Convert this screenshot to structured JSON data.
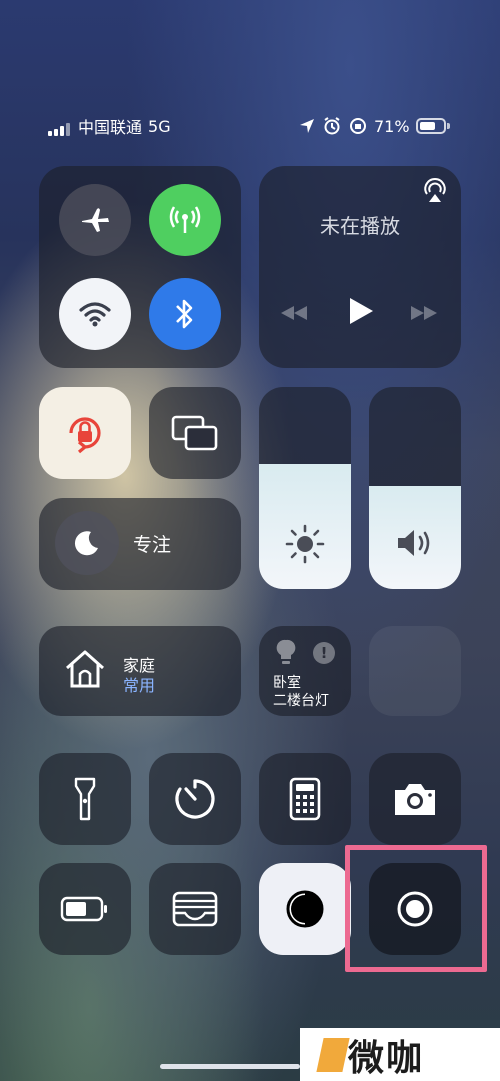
{
  "status_bar": {
    "carrier": "中国联通",
    "network": "5G",
    "battery_percent": "71%",
    "battery_level": 0.71
  },
  "connectivity": {
    "airplane_icon": "airplane-icon",
    "cellular_icon": "antenna-icon",
    "wifi_icon": "wifi-icon",
    "bluetooth_icon": "bluetooth-icon",
    "cellular_color": "#4fcf60",
    "bluetooth_color": "#2f7ae9"
  },
  "media": {
    "status": "未在播放"
  },
  "focus": {
    "label": "专注"
  },
  "home": {
    "title": "家庭",
    "subtitle": "常用"
  },
  "accessory": {
    "room": "卧室",
    "name": "二楼台灯"
  },
  "sliders": {
    "brightness_level": 0.62,
    "volume_level": 0.51
  },
  "watermark": {
    "text": "微咖"
  },
  "colors": {
    "highlight": "#ec6a91"
  }
}
